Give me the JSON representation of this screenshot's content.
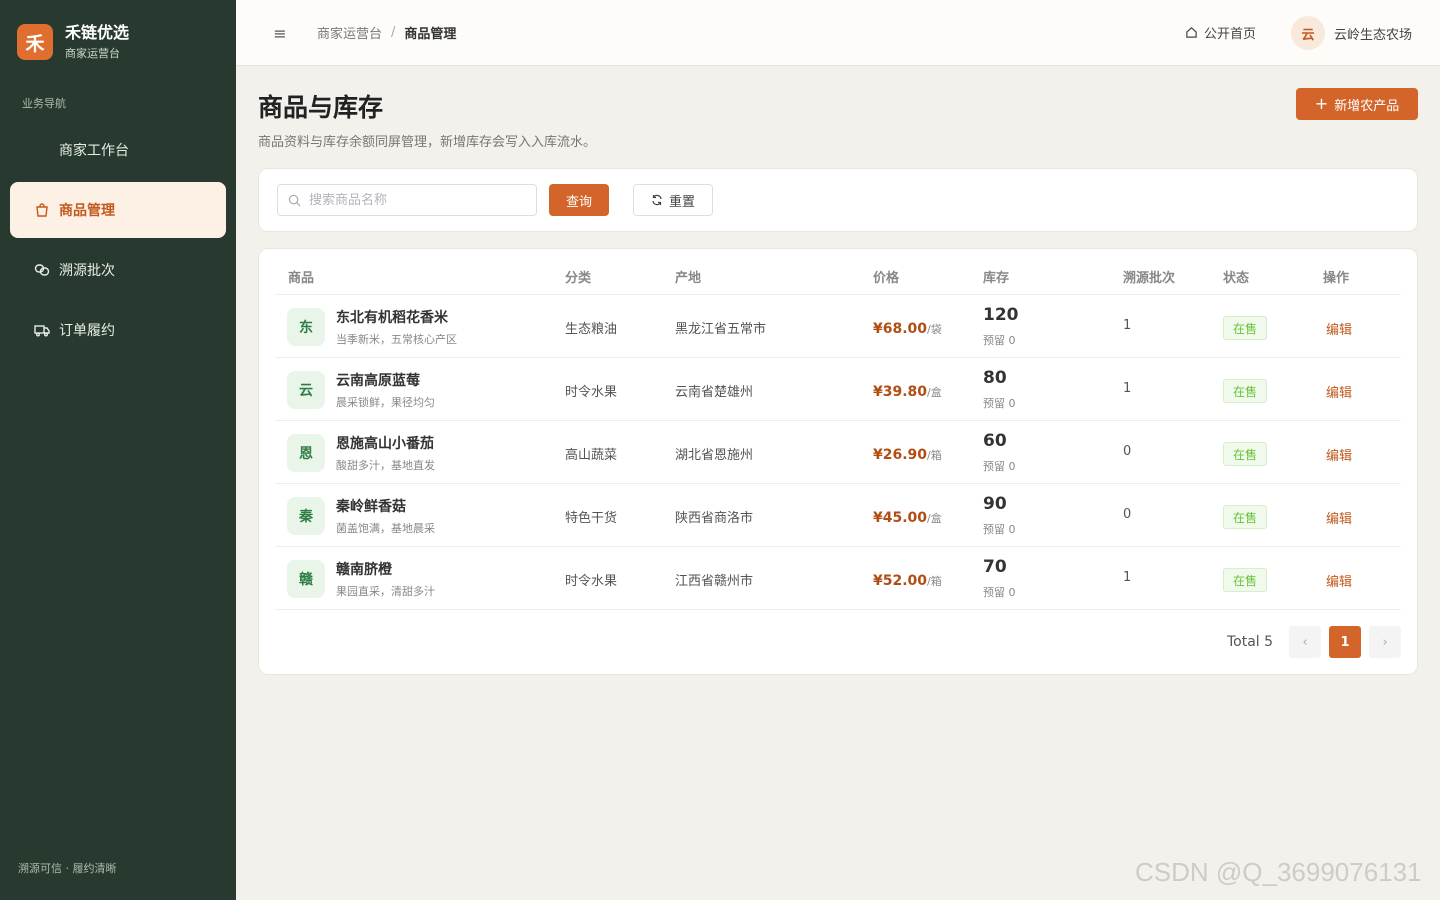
{
  "brand": {
    "logo_char": "禾",
    "name": "禾链优选",
    "subtitle": "商家运营台"
  },
  "sidebar": {
    "section_title": "业务导航",
    "items": [
      {
        "label": "商家工作台",
        "icon": "none",
        "active": false
      },
      {
        "label": "商品管理",
        "icon": "shopping-bag-icon",
        "active": true
      },
      {
        "label": "溯源批次",
        "icon": "link-icon",
        "active": false
      },
      {
        "label": "订单履约",
        "icon": "truck-icon",
        "active": false
      }
    ],
    "footer": "溯源可信 · 履约清晰"
  },
  "header": {
    "breadcrumb": [
      "商家运营台",
      "商品管理"
    ],
    "breadcrumb_sep": "/",
    "home_link": "公开首页",
    "user_avatar": "云",
    "user_name": "云岭生态农场"
  },
  "page": {
    "title": "商品与库存",
    "description": "商品资料与库存余额同屏管理，新增库存会写入入库流水。",
    "add_button": "新增农产品"
  },
  "search": {
    "placeholder": "搜索商品名称",
    "value": "",
    "query_button": "查询",
    "reset_button": "重置"
  },
  "table": {
    "headers": [
      "商品",
      "分类",
      "产地",
      "价格",
      "库存",
      "溯源批次",
      "状态",
      "操作"
    ],
    "rows": [
      {
        "avatar": "东",
        "name": "东北有机稻花香米",
        "desc": "当季新米，五常核心产区",
        "category": "生态粮油",
        "origin": "黑龙江省五常市",
        "price": "¥68.00",
        "unit": "/袋",
        "stock": "120",
        "reserved": "预留 0",
        "batches": "1",
        "status": "在售",
        "action": "编辑"
      },
      {
        "avatar": "云",
        "name": "云南高原蓝莓",
        "desc": "晨采锁鲜，果径均匀",
        "category": "时令水果",
        "origin": "云南省楚雄州",
        "price": "¥39.80",
        "unit": "/盒",
        "stock": "80",
        "reserved": "预留 0",
        "batches": "1",
        "status": "在售",
        "action": "编辑"
      },
      {
        "avatar": "恩",
        "name": "恩施高山小番茄",
        "desc": "酸甜多汁，基地直发",
        "category": "高山蔬菜",
        "origin": "湖北省恩施州",
        "price": "¥26.90",
        "unit": "/箱",
        "stock": "60",
        "reserved": "预留 0",
        "batches": "0",
        "status": "在售",
        "action": "编辑"
      },
      {
        "avatar": "秦",
        "name": "秦岭鲜香菇",
        "desc": "菌盖饱满，基地晨采",
        "category": "特色干货",
        "origin": "陕西省商洛市",
        "price": "¥45.00",
        "unit": "/盒",
        "stock": "90",
        "reserved": "预留 0",
        "batches": "0",
        "status": "在售",
        "action": "编辑"
      },
      {
        "avatar": "赣",
        "name": "赣南脐橙",
        "desc": "果园直采，清甜多汁",
        "category": "时令水果",
        "origin": "江西省赣州市",
        "price": "¥52.00",
        "unit": "/箱",
        "stock": "70",
        "reserved": "预留 0",
        "batches": "1",
        "status": "在售",
        "action": "编辑"
      }
    ]
  },
  "pagination": {
    "total_label": "Total 5",
    "current": "1",
    "prev": "‹",
    "next": "›"
  },
  "watermark": "CSDN @Q_3699076131",
  "colors": {
    "sidebar_bg": "#283a2f",
    "accent": "#d4652a",
    "active_bg": "#fdf1e6",
    "success": "#67c23a"
  }
}
